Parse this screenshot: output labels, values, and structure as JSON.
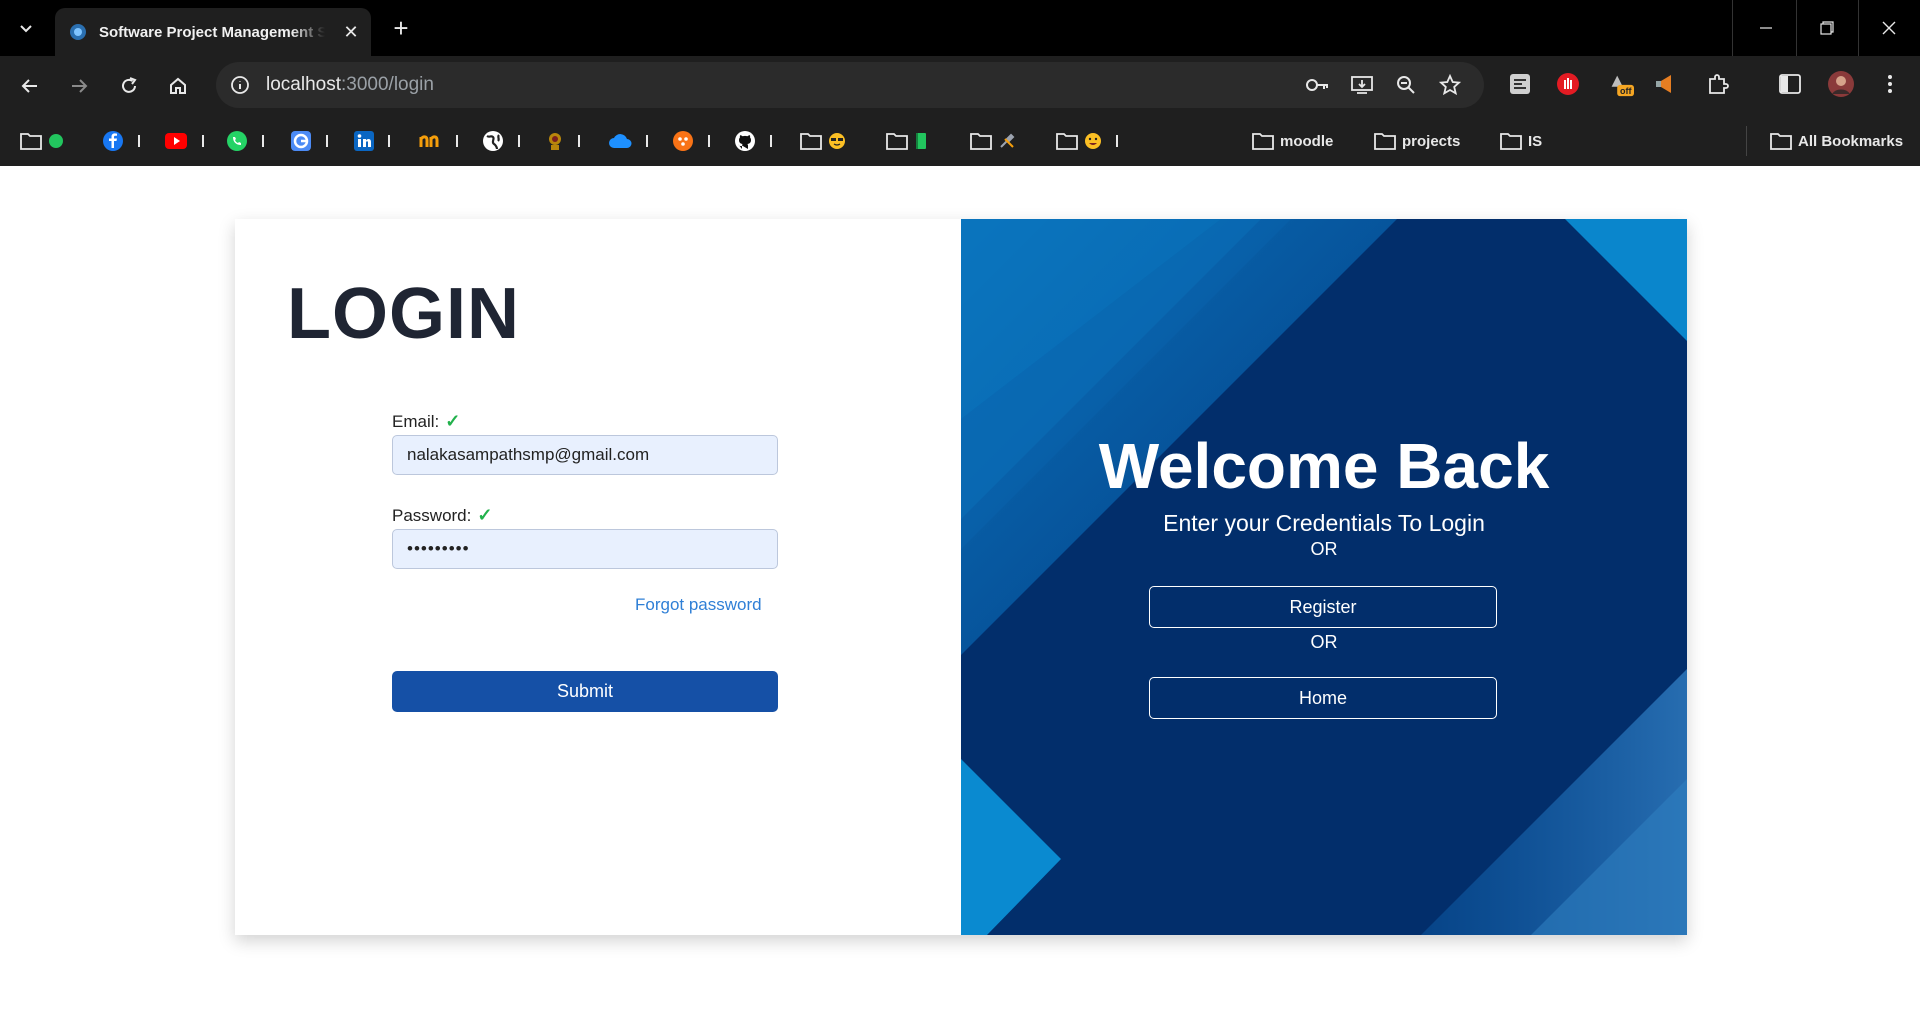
{
  "browser": {
    "tab_title": "Software Project Management Sy",
    "url_host": "localhost",
    "url_path": ":3000/login",
    "extension_badge": "off",
    "bookmarks": {
      "moodle": "moodle",
      "projects": "projects",
      "is": "IS",
      "all_bookmarks": "All Bookmarks"
    }
  },
  "login": {
    "title": "LOGIN",
    "email_label": "Email:",
    "email_value": "nalakasampathsmp@gmail.com",
    "password_label": "Password:",
    "password_value": "•••••••••",
    "forgot_label": "Forgot password",
    "submit_label": "Submit"
  },
  "welcome": {
    "heading": "Welcome Back",
    "subtitle": "Enter your Credentials To Login",
    "or_1": "OR",
    "register_label": "Register",
    "or_2": "OR",
    "home_label": "Home"
  },
  "colors": {
    "primary": "#1550a6",
    "panel": "#022e6b",
    "link": "#2f7fd6",
    "check": "#22b14c"
  }
}
